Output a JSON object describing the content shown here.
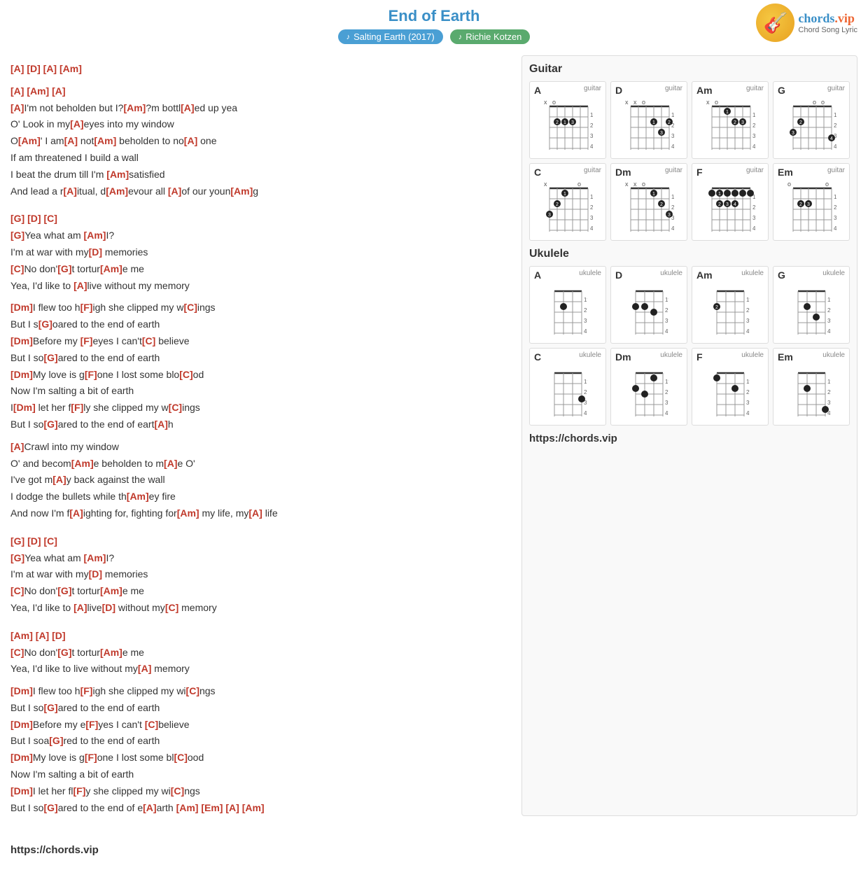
{
  "page": {
    "title": "End of Earth",
    "album": "Salting Earth (2017)",
    "artist": "Richie Kotzen",
    "url": "https://chords.vip"
  },
  "lyrics": [
    {
      "type": "chord-line",
      "text": "[A] [D] [A] [Am]"
    },
    {
      "type": "chord-line",
      "text": "[A] [Am] [A]"
    },
    {
      "type": "lyric",
      "parts": [
        {
          "t": "[A]",
          "c": true
        },
        {
          "t": "I'm not beholden but I?"
        },
        {
          "t": "[Am]",
          "c": true
        },
        {
          "t": "?m bottl"
        },
        {
          "t": "[A]",
          "c": true
        },
        {
          "t": "ed up yea"
        }
      ]
    },
    {
      "type": "lyric",
      "parts": [
        {
          "t": "O' Look in my"
        },
        {
          "t": "[A]",
          "c": true
        },
        {
          "t": "eyes into my window"
        }
      ]
    },
    {
      "type": "lyric",
      "parts": [
        {
          "t": "O"
        },
        {
          "t": "[Am]",
          "c": true
        },
        {
          "t": "' I am"
        },
        {
          "t": "[A]",
          "c": true
        },
        {
          "t": " not"
        },
        {
          "t": "[Am]",
          "c": true
        },
        {
          "t": " beholden to no"
        },
        {
          "t": "[A]",
          "c": true
        },
        {
          "t": " one"
        }
      ]
    },
    {
      "type": "lyric",
      "parts": [
        {
          "t": "If am threatened I build a wall"
        }
      ]
    },
    {
      "type": "lyric",
      "parts": [
        {
          "t": "I beat the drum till I'm "
        },
        {
          "t": "[Am]",
          "c": true
        },
        {
          "t": "satisfied"
        }
      ]
    },
    {
      "type": "lyric",
      "parts": [
        {
          "t": "And lead a r"
        },
        {
          "t": "[A]",
          "c": true
        },
        {
          "t": "itual, d"
        },
        {
          "t": "[Am]",
          "c": true
        },
        {
          "t": "evour all "
        },
        {
          "t": "[A]",
          "c": true
        },
        {
          "t": "of our youn"
        },
        {
          "t": "[Am]",
          "c": true
        },
        {
          "t": "g"
        }
      ]
    },
    {
      "type": "blank"
    },
    {
      "type": "chord-line",
      "text": "[G] [D] [C]"
    },
    {
      "type": "lyric",
      "parts": [
        {
          "t": "[G]",
          "c": true
        },
        {
          "t": "Yea what am "
        },
        {
          "t": "[Am]",
          "c": true
        },
        {
          "t": "I?"
        }
      ]
    },
    {
      "type": "lyric",
      "parts": [
        {
          "t": "I'm at war with my"
        },
        {
          "t": "[D]",
          "c": true
        },
        {
          "t": " memories"
        }
      ]
    },
    {
      "type": "lyric",
      "parts": [
        {
          "t": "[C]",
          "c": true
        },
        {
          "t": "No don'"
        },
        {
          "t": "[G]",
          "c": true
        },
        {
          "t": "t tortur"
        },
        {
          "t": "[Am]",
          "c": true
        },
        {
          "t": "e me"
        }
      ]
    },
    {
      "type": "lyric",
      "parts": [
        {
          "t": "Yea, I'd like to "
        },
        {
          "t": "[A]",
          "c": true
        },
        {
          "t": "live without my memory"
        }
      ]
    },
    {
      "type": "blank"
    },
    {
      "type": "lyric",
      "parts": [
        {
          "t": "[Dm]",
          "c": true
        },
        {
          "t": "I flew too h"
        },
        {
          "t": "[F]",
          "c": true
        },
        {
          "t": "igh she clipped my w"
        },
        {
          "t": "[C]",
          "c": true
        },
        {
          "t": "ings"
        }
      ]
    },
    {
      "type": "lyric",
      "parts": [
        {
          "t": "But I s"
        },
        {
          "t": "[G]",
          "c": true
        },
        {
          "t": "oared to the end of earth"
        }
      ]
    },
    {
      "type": "lyric",
      "parts": [
        {
          "t": "[Dm]",
          "c": true
        },
        {
          "t": "Before my "
        },
        {
          "t": "[F]",
          "c": true
        },
        {
          "t": "eyes I can't"
        },
        {
          "t": "[C]",
          "c": true
        },
        {
          "t": " believe"
        }
      ]
    },
    {
      "type": "lyric",
      "parts": [
        {
          "t": "But I so"
        },
        {
          "t": "[G]",
          "c": true
        },
        {
          "t": "ared to the end of earth"
        }
      ]
    },
    {
      "type": "lyric",
      "parts": [
        {
          "t": "[Dm]",
          "c": true
        },
        {
          "t": "My love is g"
        },
        {
          "t": "[F]",
          "c": true
        },
        {
          "t": "one I lost some blo"
        },
        {
          "t": "[C]",
          "c": true
        },
        {
          "t": "od"
        }
      ]
    },
    {
      "type": "lyric",
      "parts": [
        {
          "t": "Now I'm salting a bit of earth"
        }
      ]
    },
    {
      "type": "lyric",
      "parts": [
        {
          "t": "I"
        },
        {
          "t": "[Dm]",
          "c": true
        },
        {
          "t": " let her f"
        },
        {
          "t": "[F]",
          "c": true
        },
        {
          "t": "ly she clipped my w"
        },
        {
          "t": "[C]",
          "c": true
        },
        {
          "t": "ings"
        }
      ]
    },
    {
      "type": "lyric",
      "parts": [
        {
          "t": "But I so"
        },
        {
          "t": "[G]",
          "c": true
        },
        {
          "t": "ared to the end of eart"
        },
        {
          "t": "[A]",
          "c": true
        },
        {
          "t": "h"
        }
      ]
    },
    {
      "type": "blank"
    },
    {
      "type": "lyric",
      "parts": [
        {
          "t": "[A]",
          "c": true
        },
        {
          "t": "Crawl into my window"
        }
      ]
    },
    {
      "type": "lyric",
      "parts": [
        {
          "t": "O' and becom"
        },
        {
          "t": "[Am]",
          "c": true
        },
        {
          "t": "e beholden to m"
        },
        {
          "t": "[A]",
          "c": true
        },
        {
          "t": "e O'"
        }
      ]
    },
    {
      "type": "lyric",
      "parts": [
        {
          "t": "I've got m"
        },
        {
          "t": "[A]",
          "c": true
        },
        {
          "t": "y back against the wall"
        }
      ]
    },
    {
      "type": "lyric",
      "parts": [
        {
          "t": "I dodge the bullets while th"
        },
        {
          "t": "[Am]",
          "c": true
        },
        {
          "t": "ey fire"
        }
      ]
    },
    {
      "type": "lyric",
      "parts": [
        {
          "t": "And now I'm f"
        },
        {
          "t": "[A]",
          "c": true
        },
        {
          "t": "ighting for, fighting for"
        },
        {
          "t": "[Am]",
          "c": true
        },
        {
          "t": " my life, my"
        },
        {
          "t": "[A]",
          "c": true
        },
        {
          "t": " life"
        }
      ]
    },
    {
      "type": "blank"
    },
    {
      "type": "chord-line",
      "text": "[G] [D] [C]"
    },
    {
      "type": "lyric",
      "parts": [
        {
          "t": "[G]",
          "c": true
        },
        {
          "t": "Yea what am "
        },
        {
          "t": "[Am]",
          "c": true
        },
        {
          "t": "I?"
        }
      ]
    },
    {
      "type": "lyric",
      "parts": [
        {
          "t": "I'm at war with my"
        },
        {
          "t": "[D]",
          "c": true
        },
        {
          "t": " memories"
        }
      ]
    },
    {
      "type": "lyric",
      "parts": [
        {
          "t": "[C]",
          "c": true
        },
        {
          "t": "No don'"
        },
        {
          "t": "[G]",
          "c": true
        },
        {
          "t": "t tortur"
        },
        {
          "t": "[Am]",
          "c": true
        },
        {
          "t": "e me"
        }
      ]
    },
    {
      "type": "lyric",
      "parts": [
        {
          "t": "Yea, I'd like to "
        },
        {
          "t": "[A]",
          "c": true
        },
        {
          "t": "live"
        },
        {
          "t": "[D]",
          "c": true
        },
        {
          "t": " without my"
        },
        {
          "t": "[C]",
          "c": true
        },
        {
          "t": " memory"
        }
      ]
    },
    {
      "type": "blank"
    },
    {
      "type": "chord-line",
      "text": "[Am] [A] [D]"
    },
    {
      "type": "lyric",
      "parts": [
        {
          "t": "[C]",
          "c": true
        },
        {
          "t": "No don'"
        },
        {
          "t": "[G]",
          "c": true
        },
        {
          "t": "t tortur"
        },
        {
          "t": "[Am]",
          "c": true
        },
        {
          "t": "e me"
        }
      ]
    },
    {
      "type": "lyric",
      "parts": [
        {
          "t": "Yea, I'd like to live without my"
        },
        {
          "t": "[A]",
          "c": true
        },
        {
          "t": " memory"
        }
      ]
    },
    {
      "type": "blank"
    },
    {
      "type": "lyric",
      "parts": [
        {
          "t": "[Dm]",
          "c": true
        },
        {
          "t": "I flew too h"
        },
        {
          "t": "[F]",
          "c": true
        },
        {
          "t": "igh she clipped my wi"
        },
        {
          "t": "[C]",
          "c": true
        },
        {
          "t": "ngs"
        }
      ]
    },
    {
      "type": "lyric",
      "parts": [
        {
          "t": "But I so"
        },
        {
          "t": "[G]",
          "c": true
        },
        {
          "t": "ared to the end of earth"
        }
      ]
    },
    {
      "type": "lyric",
      "parts": [
        {
          "t": "[Dm]",
          "c": true
        },
        {
          "t": "Before my e"
        },
        {
          "t": "[F]",
          "c": true
        },
        {
          "t": "yes I can't "
        },
        {
          "t": "[C]",
          "c": true
        },
        {
          "t": "believe"
        }
      ]
    },
    {
      "type": "lyric",
      "parts": [
        {
          "t": "But I soa"
        },
        {
          "t": "[G]",
          "c": true
        },
        {
          "t": "red to the end of earth"
        }
      ]
    },
    {
      "type": "lyric",
      "parts": [
        {
          "t": "[Dm]",
          "c": true
        },
        {
          "t": "My love is g"
        },
        {
          "t": "[F]",
          "c": true
        },
        {
          "t": "one I lost some bl"
        },
        {
          "t": "[C]",
          "c": true
        },
        {
          "t": "ood"
        }
      ]
    },
    {
      "type": "lyric",
      "parts": [
        {
          "t": "Now I'm salting a bit of earth"
        }
      ]
    },
    {
      "type": "lyric",
      "parts": [
        {
          "t": "[Dm]",
          "c": true
        },
        {
          "t": "I let her fl"
        },
        {
          "t": "[F]",
          "c": true
        },
        {
          "t": "y she clipped my wi"
        },
        {
          "t": "[C]",
          "c": true
        },
        {
          "t": "ngs"
        }
      ]
    },
    {
      "type": "lyric",
      "parts": [
        {
          "t": "But I so"
        },
        {
          "t": "[G]",
          "c": true
        },
        {
          "t": "ared to the end of e"
        },
        {
          "t": "[A]",
          "c": true
        },
        {
          "t": "arth "
        },
        {
          "t": "[Am]",
          "c": true
        },
        {
          "t": " "
        },
        {
          "t": "[Em]",
          "c": true
        },
        {
          "t": " "
        },
        {
          "t": "[A]",
          "c": true
        },
        {
          "t": " "
        },
        {
          "t": "[Am]",
          "c": true
        }
      ]
    }
  ]
}
